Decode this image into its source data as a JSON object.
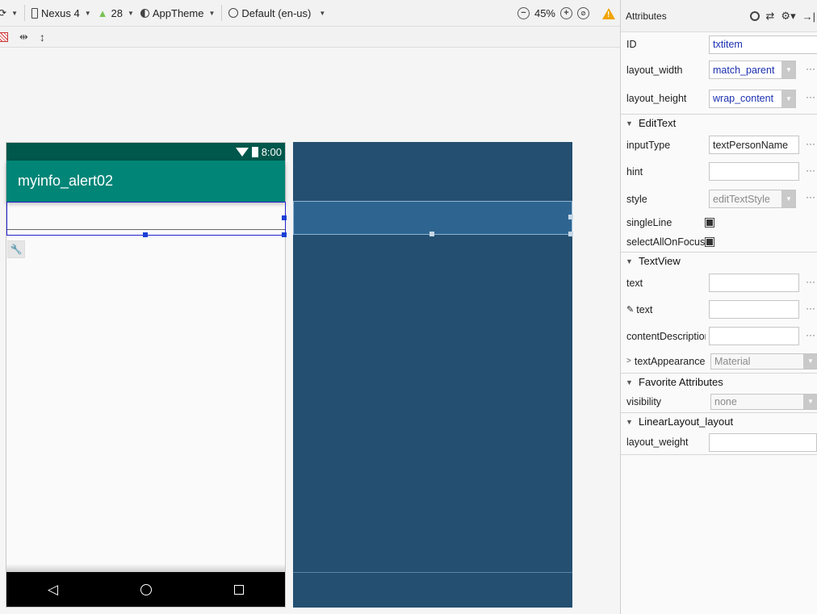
{
  "toolbar": {
    "device": "Nexus 4",
    "api_level": "28",
    "theme": "AppTheme",
    "locale": "Default (en-us)",
    "zoom_level": "45%"
  },
  "phone": {
    "status_time": "8:00",
    "app_title": "myinfo_alert02"
  },
  "attributes": {
    "panel_title": "Attributes",
    "id_label": "ID",
    "id_value": "txtitem",
    "layout_width_label": "layout_width",
    "layout_width_value": "match_parent",
    "layout_height_label": "layout_height",
    "layout_height_value": "wrap_content",
    "edittext_section": "EditText",
    "inputtype_label": "inputType",
    "inputtype_value": "textPersonName",
    "hint_label": "hint",
    "hint_value": "",
    "style_label": "style",
    "style_value": "editTextStyle",
    "singleline_label": "singleLine",
    "selectallonfocus_label": "selectAllOnFocus",
    "textview_section": "TextView",
    "text_label": "text",
    "text_value": "",
    "text_tools_label": "text",
    "text_tools_value": "",
    "contentdesc_label": "contentDescription",
    "contentdesc_value": "",
    "textappearance_label": "textAppearance",
    "textappearance_value": "Material",
    "favorite_section": "Favorite Attributes",
    "visibility_label": "visibility",
    "visibility_value": "none",
    "linearlayout_section": "LinearLayout_layout",
    "layoutweight_label": "layout_weight",
    "layoutweight_value": ""
  },
  "colors": {
    "status_bar": "#00574b",
    "app_bar": "#008577",
    "blueprint": "#244f70",
    "selection": "#2222cc"
  }
}
